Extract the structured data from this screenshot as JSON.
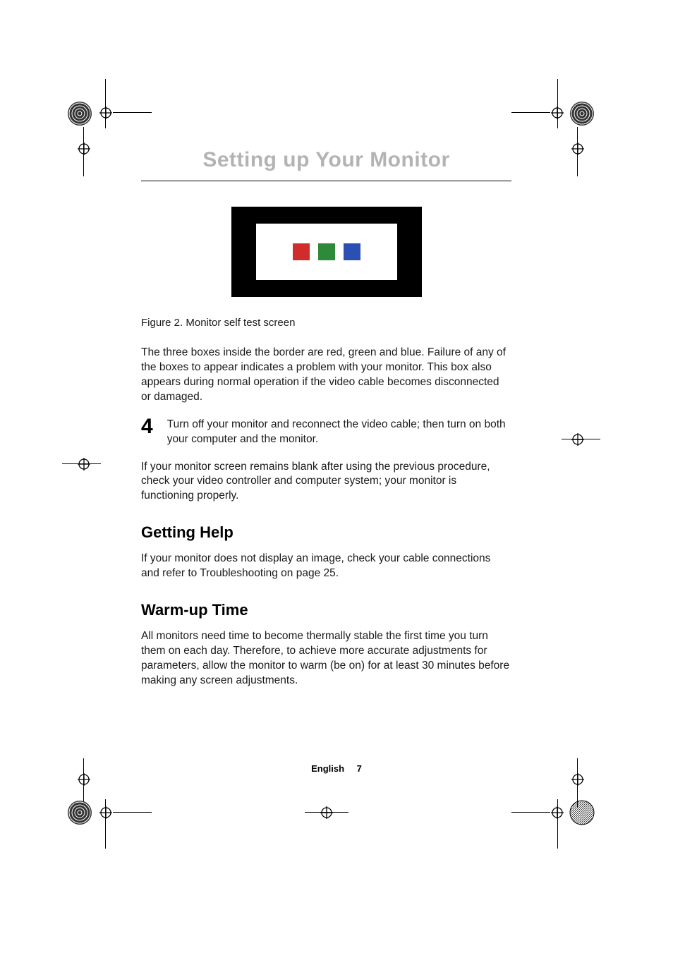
{
  "chapter_title": "Setting up Your Monitor",
  "figure": {
    "caption": "Figure 2.  Monitor self test screen"
  },
  "para1": "The three boxes inside the border are red, green and blue. Failure of any of the boxes to appear indicates a problem with your monitor. This box also appears during normal operation if the video cable becomes disconnected or damaged.",
  "step4": {
    "number": "4",
    "text": "Turn off your monitor and reconnect the video cable; then turn on both your computer and the monitor."
  },
  "para2": "If your monitor screen remains blank after using the previous procedure, check your video controller and computer system; your monitor is functioning properly.",
  "section_help": {
    "heading": "Getting Help",
    "text": "If your monitor does not display an image, check your cable connections and refer to Troubleshooting on page 25."
  },
  "section_warmup": {
    "heading": "Warm-up Time",
    "text": "All monitors need time to become thermally stable the first time you turn them on each day. Therefore, to achieve more accurate adjustments for parameters, allow the monitor to warm (be on) for at least 30 minutes before making any screen adjustments."
  },
  "footer": {
    "language": "English",
    "page_number": "7"
  }
}
